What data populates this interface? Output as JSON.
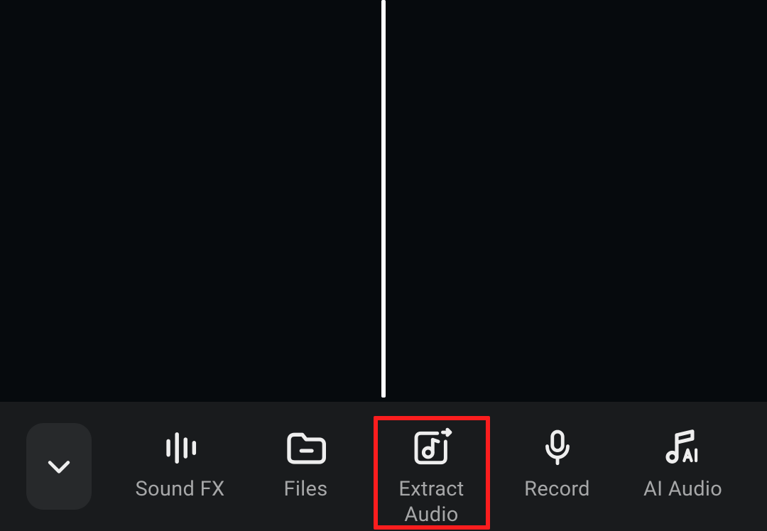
{
  "toolbar": {
    "collapse": {
      "name": "collapse-button",
      "icon": "chevron-down-icon"
    },
    "items": [
      {
        "name": "sound-fx",
        "label": "Sound FX",
        "icon": "soundfx-icon",
        "highlighted": false
      },
      {
        "name": "files",
        "label": "Files",
        "icon": "folder-minus-icon",
        "highlighted": false
      },
      {
        "name": "extract-audio",
        "label": "Extract\nAudio",
        "icon": "extract-audio-icon",
        "highlighted": true
      },
      {
        "name": "record",
        "label": "Record",
        "icon": "microphone-icon",
        "highlighted": false
      },
      {
        "name": "ai-audio",
        "label": "AI Audio",
        "icon": "ai-music-icon",
        "highlighted": false
      }
    ]
  },
  "colors": {
    "highlight": "#fb1d1e",
    "toolbar_bg": "#191b1d",
    "icon": "#eeeeee",
    "label": "#a6a7a8"
  }
}
